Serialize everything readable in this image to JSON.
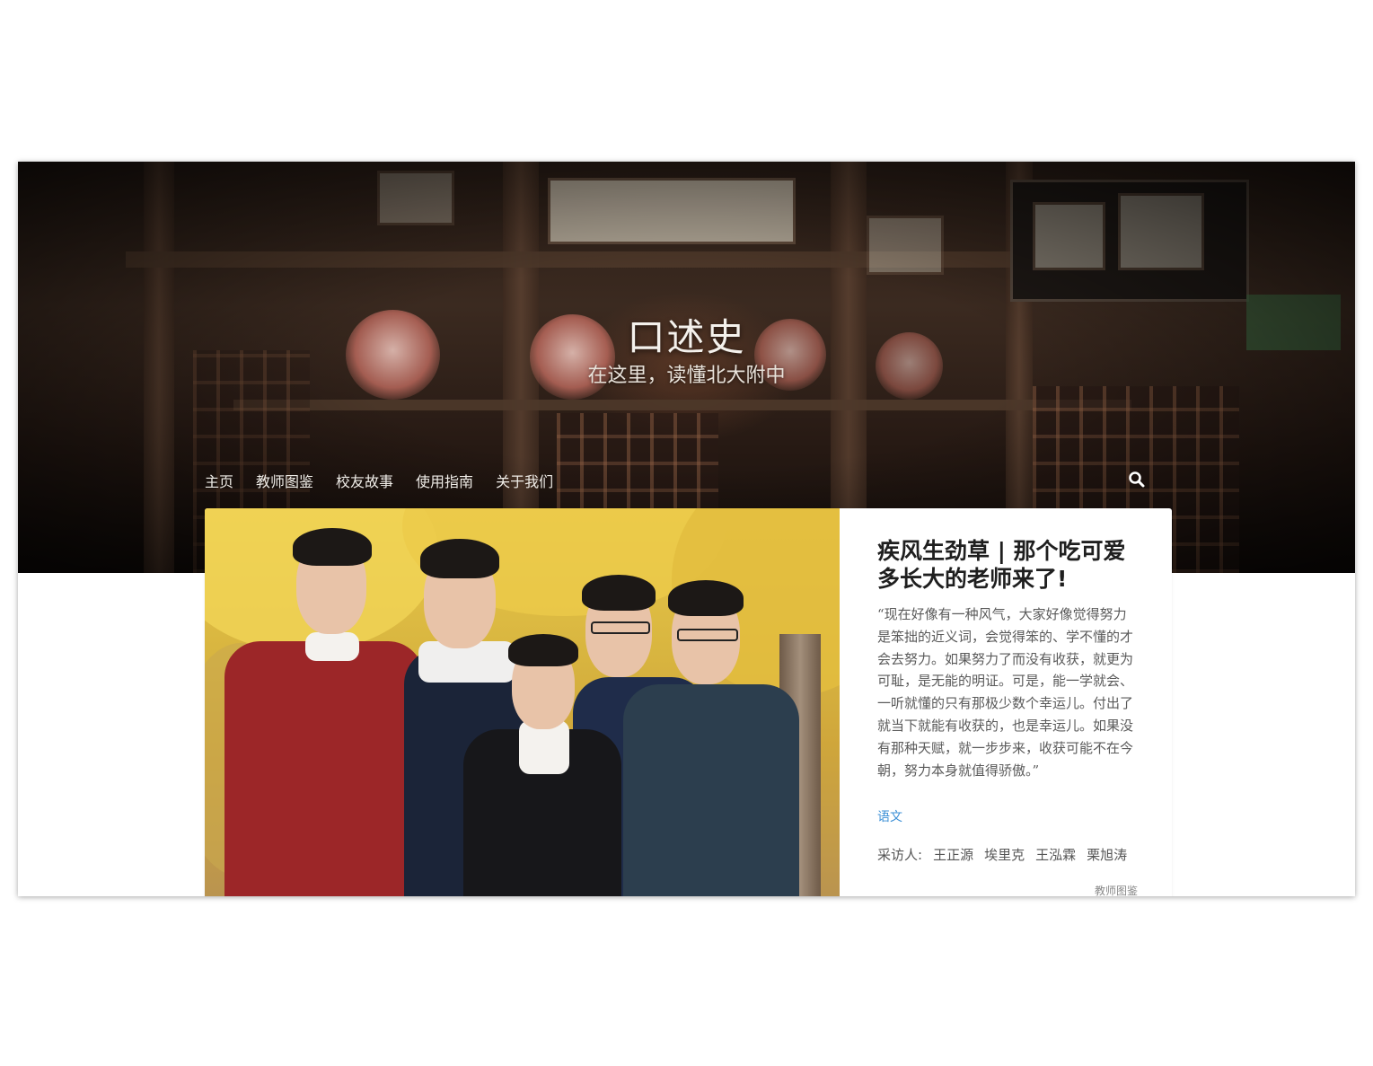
{
  "site": {
    "title": "口述史",
    "tagline": "在这里，读懂北大附中"
  },
  "nav": {
    "items": [
      {
        "label": "主页"
      },
      {
        "label": "教师图鉴"
      },
      {
        "label": "校友故事"
      },
      {
        "label": "使用指南"
      },
      {
        "label": "关于我们"
      }
    ],
    "search_icon": "search-icon"
  },
  "featured": {
    "title": "疾风生劲草 | 那个吃可爱多长大的老师来了!",
    "excerpt": "“现在好像有一种风气，大家好像觉得努力是笨拙的近义词，会觉得笨的、学不懂的才会去努力。如果努力了而没有收获，就更为可耻，是无能的明证。可是，能一学就会、一听就懂的只有那极少数个幸运儿。付出了就当下就能有收获的，也是幸运儿。如果没有那种天赋，就一步步来，收获可能不在今朝，努力本身就值得骄傲。”",
    "category": "语文",
    "interviewers_label": "采访人:",
    "interviewers": [
      "王正源",
      "埃里克",
      "王泓霖",
      "栗旭涛"
    ],
    "section": "教师图鉴"
  },
  "colors": {
    "accent_link": "#3b8fd6",
    "title_text": "#1f1f1f",
    "body_text": "#5a5a5a"
  }
}
